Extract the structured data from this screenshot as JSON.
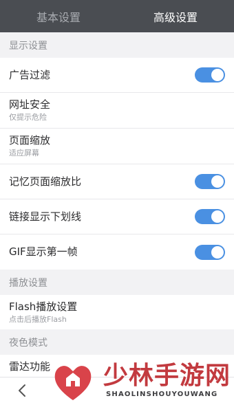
{
  "tabs": {
    "basic": "基本设置",
    "advanced": "高级设置"
  },
  "display": {
    "header": "显示设置",
    "ad_filter": {
      "title": "广告过滤",
      "enabled": true
    },
    "url_safety": {
      "title": "网址安全",
      "subtitle": "仅提示危险"
    },
    "page_zoom": {
      "title": "页面缩放",
      "subtitle": "适应屏幕"
    },
    "remember_zoom": {
      "title": "记忆页面缩放比",
      "enabled": true
    },
    "link_underline": {
      "title": "链接显示下划线",
      "enabled": true
    },
    "gif_first_frame": {
      "title": "GIF显示第一帧",
      "enabled": true
    }
  },
  "playback": {
    "header": "播放设置",
    "flash": {
      "title": "Flash播放设置",
      "subtitle": "点击后播放Flash"
    }
  },
  "night": {
    "header": "夜色模式",
    "radar": {
      "title": "雷达功能"
    }
  },
  "watermark": {
    "title": "少林手游网",
    "subtitle": "SHAOLINSHOUYOUWANG"
  },
  "colors": {
    "accent": "#4a90e2",
    "tabbar": "#4a4d52",
    "watermark_red": "#c23a3f"
  }
}
